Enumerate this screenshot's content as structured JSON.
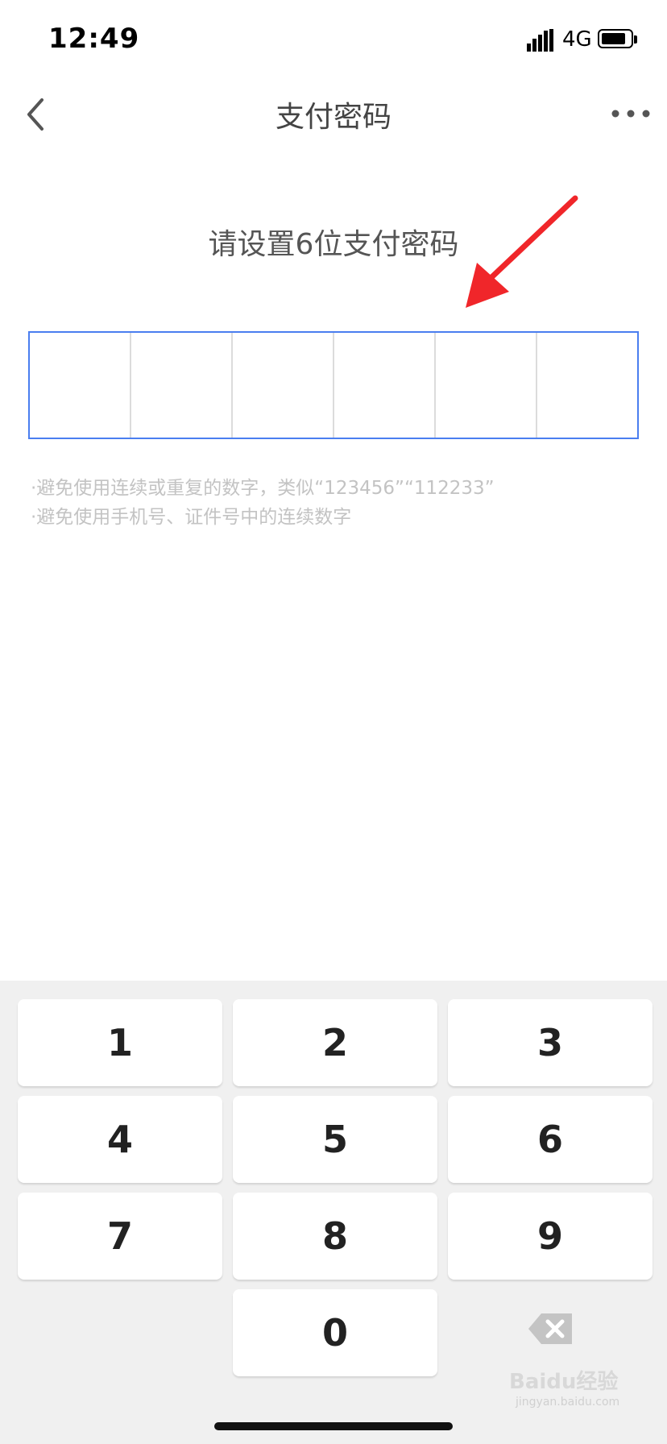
{
  "status_bar": {
    "time": "12:49",
    "network": "4G"
  },
  "nav": {
    "title": "支付密码"
  },
  "prompt": "请设置6位支付密码",
  "tips": [
    "·避免使用连续或重复的数字，类似“123456”“112233”",
    "·避免使用手机号、证件号中的连续数字"
  ],
  "keypad": {
    "keys": [
      "1",
      "2",
      "3",
      "4",
      "5",
      "6",
      "7",
      "8",
      "9",
      "0"
    ]
  },
  "watermark": {
    "text": "Baidu经验",
    "sub": "jingyan.baidu.com"
  },
  "colors": {
    "accent": "#4a7ef0",
    "annotation_arrow": "#f0262a"
  },
  "icons": {
    "back": "chevron-left-icon",
    "more": "more-dots-icon",
    "delete": "backspace-icon"
  }
}
